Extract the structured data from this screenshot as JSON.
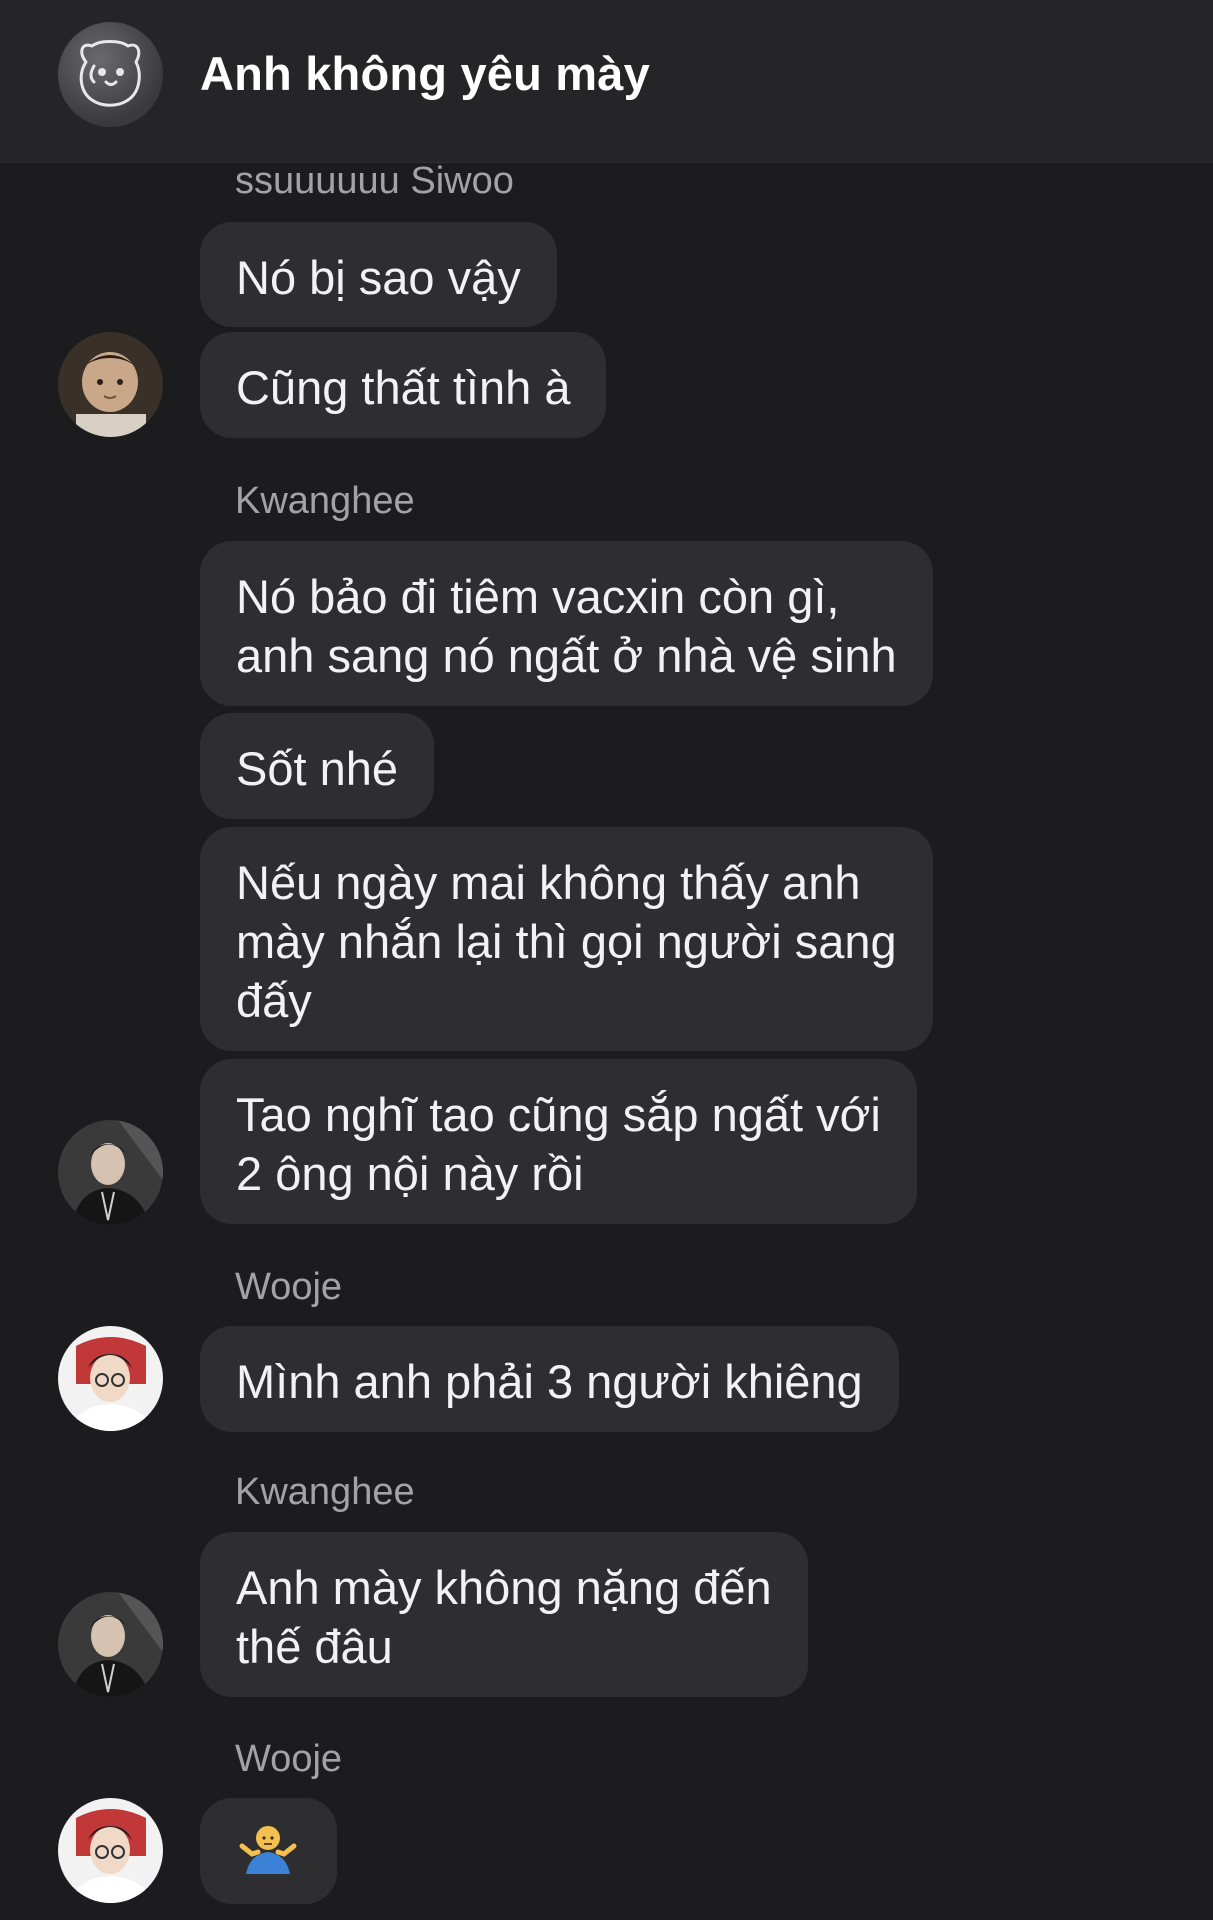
{
  "header": {
    "title": "Anh không yêu mày",
    "avatar_icon": "bear-face-icon"
  },
  "messages": [
    {
      "sender": "ssuuuuuu Siwoo",
      "bubbles": [
        {
          "lines": [
            "Nó bị sao vậy"
          ]
        },
        {
          "lines": [
            "Cũng thất tình à"
          ]
        }
      ],
      "avatar": "baby-photo-avatar"
    },
    {
      "sender": "Kwanghee",
      "bubbles": [
        {
          "lines": [
            "Nó bảo đi tiêm vacxin còn gì,",
            "anh sang nó ngất ở nhà vệ sinh"
          ]
        },
        {
          "lines": [
            "Sốt nhé"
          ]
        },
        {
          "lines": [
            "Nếu ngày mai không thấy anh",
            "mày nhắn lại thì gọi người sang",
            "đấy"
          ]
        },
        {
          "lines": [
            "Tao nghĩ tao cũng sắp ngất với",
            "2 ông nội này rồi"
          ]
        }
      ],
      "avatar": "man-dark-jacket-avatar"
    },
    {
      "sender": "Wooje",
      "bubbles": [
        {
          "lines": [
            "Mình anh phải 3 người khiêng"
          ]
        }
      ],
      "avatar": "gamer-chair-avatar"
    },
    {
      "sender": "Kwanghee",
      "bubbles": [
        {
          "lines": [
            "Anh mày không nặng đến",
            "thế đâu"
          ]
        }
      ],
      "avatar": "man-dark-jacket-avatar"
    },
    {
      "sender": "Wooje",
      "bubbles": [
        {
          "emoji": "man-shrugging-emoji"
        }
      ],
      "avatar": "gamer-chair-avatar"
    }
  ],
  "colors": {
    "background": "#1c1c1e",
    "header": "#252527",
    "bubble": "#2e2e31",
    "text": "#f2f2f4",
    "sender": "#a2a2a7"
  }
}
